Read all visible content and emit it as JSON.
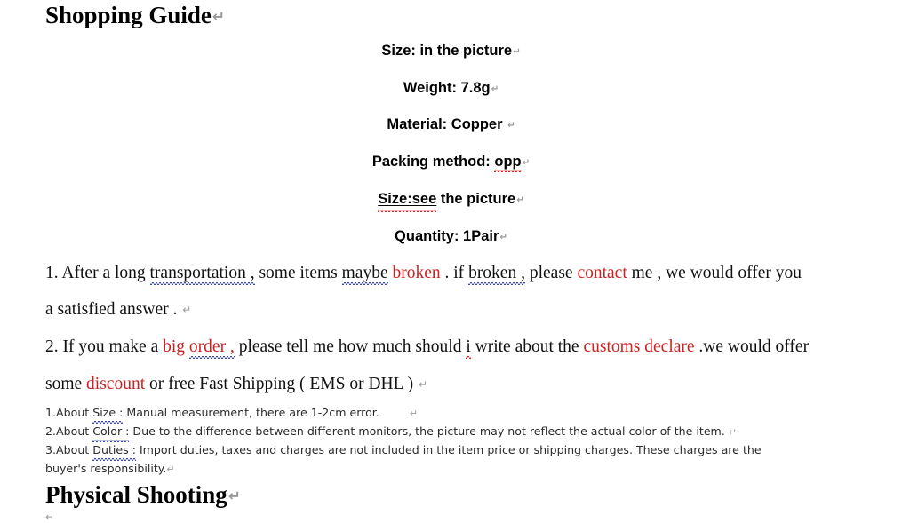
{
  "document": {
    "title_top": "Shopping Guide",
    "title_bottom": "Physical Shooting",
    "return_mark": "↵"
  },
  "specs": [
    {
      "label": "Size:",
      "value": " in the picture"
    },
    {
      "label": "Weight:",
      "value": " 7.8g"
    },
    {
      "label": "Material:",
      "value": " Copper "
    },
    {
      "label": "Packing method:",
      "value": " opp",
      "value_misspelled": "opp"
    },
    {
      "label": "Size:see",
      "value": " the picture",
      "label_underlined": true
    },
    {
      "label": "Quantity:",
      "value": " 1Pair"
    }
  ],
  "paragraphs": {
    "p1_line1_a": "1. After a long ",
    "p1_line1_transportation": "transportation ,",
    "p1_line1_b": " some items ",
    "p1_line1_maybe": "maybe",
    "p1_line1_c": " ",
    "p1_line1_broken_red": "broken",
    "p1_line1_d": " . if ",
    "p1_line1_broken2": "broken ,",
    "p1_line1_e": " please ",
    "p1_line1_contact_red": "contact",
    "p1_line1_f": " me , we would offer you",
    "p1_line2": "a satisfied answer . ",
    "p2_line1_a": "2. If you make a ",
    "p2_line1_big_red": "big ",
    "p2_line1_order_red": "order ,",
    "p2_line1_b": " please tell me how much should ",
    "p2_line1_i": "i",
    "p2_line1_c": " write about the ",
    "p2_line1_customs_red": "customs declare",
    "p2_line1_d": " .we would offer",
    "p2_line2_a": "some ",
    "p2_line2_discount_red": "discount",
    "p2_line2_b": " or free Fast Shipping ( EMS or DHL ) "
  },
  "notes": [
    {
      "number": "1.About ",
      "term": "Size :",
      "text": " Manual measurement, there are 1-2cm error.",
      "trailing_return": true
    },
    {
      "number": "2.About ",
      "term": "Color :",
      "text": " Due to the difference between different monitors, the picture may not reflect the actual color of the item. ",
      "trailing_return": true
    },
    {
      "number": "3.About ",
      "term": "Duties :",
      "text": " Import duties, taxes and charges are not included in the item price or shipping charges. These charges are the",
      "trailing_return": false
    }
  ],
  "notes_wrap_line": "buyer's responsibility.",
  "colors": {
    "highlight_red": "#cc2222",
    "spell_squiggle_red": "#dd2222",
    "grammar_squiggle_blue": "#3a4bb0",
    "return_mark_gray": "#9a9a9a",
    "body_text": "#111111",
    "background": "#ffffff"
  }
}
